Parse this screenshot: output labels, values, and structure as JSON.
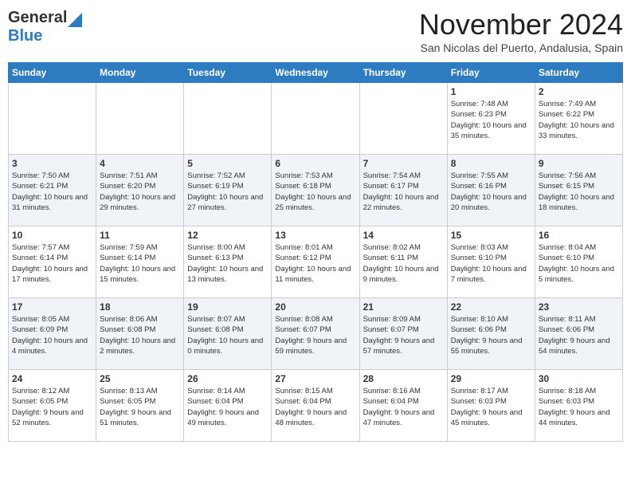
{
  "logo": {
    "line1": "General",
    "line2": "Blue",
    "arrow": "▶"
  },
  "title": "November 2024",
  "location": "San Nicolas del Puerto, Andalusia, Spain",
  "days_of_week": [
    "Sunday",
    "Monday",
    "Tuesday",
    "Wednesday",
    "Thursday",
    "Friday",
    "Saturday"
  ],
  "weeks": [
    [
      {
        "day": "",
        "sunrise": "",
        "sunset": "",
        "daylight": ""
      },
      {
        "day": "",
        "sunrise": "",
        "sunset": "",
        "daylight": ""
      },
      {
        "day": "",
        "sunrise": "",
        "sunset": "",
        "daylight": ""
      },
      {
        "day": "",
        "sunrise": "",
        "sunset": "",
        "daylight": ""
      },
      {
        "day": "",
        "sunrise": "",
        "sunset": "",
        "daylight": ""
      },
      {
        "day": "1",
        "sunrise": "Sunrise: 7:48 AM",
        "sunset": "Sunset: 6:23 PM",
        "daylight": "Daylight: 10 hours and 35 minutes."
      },
      {
        "day": "2",
        "sunrise": "Sunrise: 7:49 AM",
        "sunset": "Sunset: 6:22 PM",
        "daylight": "Daylight: 10 hours and 33 minutes."
      }
    ],
    [
      {
        "day": "3",
        "sunrise": "Sunrise: 7:50 AM",
        "sunset": "Sunset: 6:21 PM",
        "daylight": "Daylight: 10 hours and 31 minutes."
      },
      {
        "day": "4",
        "sunrise": "Sunrise: 7:51 AM",
        "sunset": "Sunset: 6:20 PM",
        "daylight": "Daylight: 10 hours and 29 minutes."
      },
      {
        "day": "5",
        "sunrise": "Sunrise: 7:52 AM",
        "sunset": "Sunset: 6:19 PM",
        "daylight": "Daylight: 10 hours and 27 minutes."
      },
      {
        "day": "6",
        "sunrise": "Sunrise: 7:53 AM",
        "sunset": "Sunset: 6:18 PM",
        "daylight": "Daylight: 10 hours and 25 minutes."
      },
      {
        "day": "7",
        "sunrise": "Sunrise: 7:54 AM",
        "sunset": "Sunset: 6:17 PM",
        "daylight": "Daylight: 10 hours and 22 minutes."
      },
      {
        "day": "8",
        "sunrise": "Sunrise: 7:55 AM",
        "sunset": "Sunset: 6:16 PM",
        "daylight": "Daylight: 10 hours and 20 minutes."
      },
      {
        "day": "9",
        "sunrise": "Sunrise: 7:56 AM",
        "sunset": "Sunset: 6:15 PM",
        "daylight": "Daylight: 10 hours and 18 minutes."
      }
    ],
    [
      {
        "day": "10",
        "sunrise": "Sunrise: 7:57 AM",
        "sunset": "Sunset: 6:14 PM",
        "daylight": "Daylight: 10 hours and 17 minutes."
      },
      {
        "day": "11",
        "sunrise": "Sunrise: 7:59 AM",
        "sunset": "Sunset: 6:14 PM",
        "daylight": "Daylight: 10 hours and 15 minutes."
      },
      {
        "day": "12",
        "sunrise": "Sunrise: 8:00 AM",
        "sunset": "Sunset: 6:13 PM",
        "daylight": "Daylight: 10 hours and 13 minutes."
      },
      {
        "day": "13",
        "sunrise": "Sunrise: 8:01 AM",
        "sunset": "Sunset: 6:12 PM",
        "daylight": "Daylight: 10 hours and 11 minutes."
      },
      {
        "day": "14",
        "sunrise": "Sunrise: 8:02 AM",
        "sunset": "Sunset: 6:11 PM",
        "daylight": "Daylight: 10 hours and 9 minutes."
      },
      {
        "day": "15",
        "sunrise": "Sunrise: 8:03 AM",
        "sunset": "Sunset: 6:10 PM",
        "daylight": "Daylight: 10 hours and 7 minutes."
      },
      {
        "day": "16",
        "sunrise": "Sunrise: 8:04 AM",
        "sunset": "Sunset: 6:10 PM",
        "daylight": "Daylight: 10 hours and 5 minutes."
      }
    ],
    [
      {
        "day": "17",
        "sunrise": "Sunrise: 8:05 AM",
        "sunset": "Sunset: 6:09 PM",
        "daylight": "Daylight: 10 hours and 4 minutes."
      },
      {
        "day": "18",
        "sunrise": "Sunrise: 8:06 AM",
        "sunset": "Sunset: 6:08 PM",
        "daylight": "Daylight: 10 hours and 2 minutes."
      },
      {
        "day": "19",
        "sunrise": "Sunrise: 8:07 AM",
        "sunset": "Sunset: 6:08 PM",
        "daylight": "Daylight: 10 hours and 0 minutes."
      },
      {
        "day": "20",
        "sunrise": "Sunrise: 8:08 AM",
        "sunset": "Sunset: 6:07 PM",
        "daylight": "Daylight: 9 hours and 59 minutes."
      },
      {
        "day": "21",
        "sunrise": "Sunrise: 8:09 AM",
        "sunset": "Sunset: 6:07 PM",
        "daylight": "Daylight: 9 hours and 57 minutes."
      },
      {
        "day": "22",
        "sunrise": "Sunrise: 8:10 AM",
        "sunset": "Sunset: 6:06 PM",
        "daylight": "Daylight: 9 hours and 55 minutes."
      },
      {
        "day": "23",
        "sunrise": "Sunrise: 8:11 AM",
        "sunset": "Sunset: 6:06 PM",
        "daylight": "Daylight: 9 hours and 54 minutes."
      }
    ],
    [
      {
        "day": "24",
        "sunrise": "Sunrise: 8:12 AM",
        "sunset": "Sunset: 6:05 PM",
        "daylight": "Daylight: 9 hours and 52 minutes."
      },
      {
        "day": "25",
        "sunrise": "Sunrise: 8:13 AM",
        "sunset": "Sunset: 6:05 PM",
        "daylight": "Daylight: 9 hours and 51 minutes."
      },
      {
        "day": "26",
        "sunrise": "Sunrise: 8:14 AM",
        "sunset": "Sunset: 6:04 PM",
        "daylight": "Daylight: 9 hours and 49 minutes."
      },
      {
        "day": "27",
        "sunrise": "Sunrise: 8:15 AM",
        "sunset": "Sunset: 6:04 PM",
        "daylight": "Daylight: 9 hours and 48 minutes."
      },
      {
        "day": "28",
        "sunrise": "Sunrise: 8:16 AM",
        "sunset": "Sunset: 6:04 PM",
        "daylight": "Daylight: 9 hours and 47 minutes."
      },
      {
        "day": "29",
        "sunrise": "Sunrise: 8:17 AM",
        "sunset": "Sunset: 6:03 PM",
        "daylight": "Daylight: 9 hours and 45 minutes."
      },
      {
        "day": "30",
        "sunrise": "Sunrise: 8:18 AM",
        "sunset": "Sunset: 6:03 PM",
        "daylight": "Daylight: 9 hours and 44 minutes."
      }
    ]
  ]
}
